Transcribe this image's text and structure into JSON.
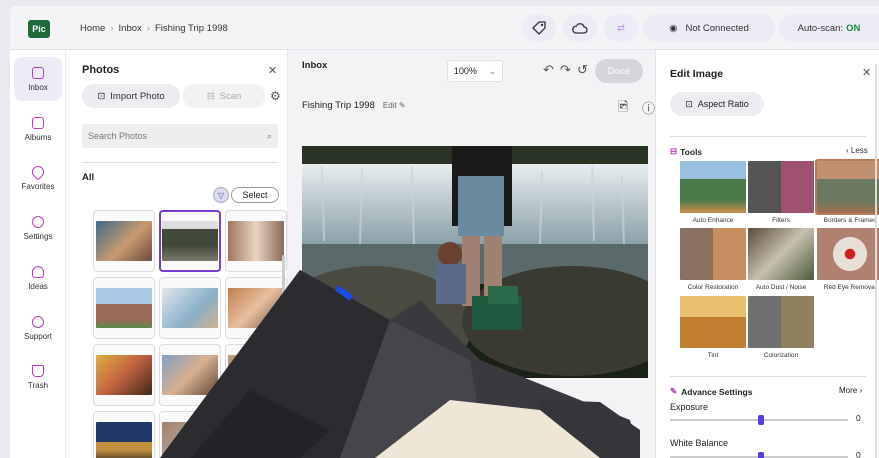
{
  "app": {
    "logo": "Pic"
  },
  "breadcrumb": [
    "Home",
    "Inbox",
    "Fishing Trip 1998"
  ],
  "topbar": {
    "connection": "Not Connected",
    "autoscan_label": "Auto-scan:",
    "autoscan_value": "ON"
  },
  "nav": [
    {
      "label": "Inbox",
      "icon": "inbox-icon",
      "active": true
    },
    {
      "label": "Albums",
      "icon": "albums-icon"
    },
    {
      "label": "Favorites",
      "icon": "heart-icon"
    },
    {
      "label": "Settings",
      "icon": "gear-icon"
    },
    {
      "label": "Ideas",
      "icon": "lightbulb-icon"
    },
    {
      "label": "Support",
      "icon": "help-icon"
    },
    {
      "label": "Trash",
      "icon": "trash-icon"
    }
  ],
  "photos": {
    "title": "Photos",
    "import_label": "Import Photo",
    "scan_label": "Scan",
    "search_placeholder": "Search Photos",
    "all_label": "All",
    "select_label": "Select"
  },
  "center": {
    "header": "Inbox",
    "zoom": "100%",
    "done": "Done",
    "album_title": "Fishing Trip 1998",
    "edit_label": "Edit"
  },
  "right": {
    "title": "Edit Image",
    "aspect_label": "Aspect Ratio",
    "tools_label": "Tools",
    "less_label": "Less",
    "tools": [
      {
        "label": "Auto Enhance"
      },
      {
        "label": "Filters"
      },
      {
        "label": "Borders & Frames"
      },
      {
        "label": "Color Restoration"
      },
      {
        "label": "Auto Dust / Noise"
      },
      {
        "label": "Red Eye Removal"
      },
      {
        "label": "Tint"
      },
      {
        "label": "Colorization"
      }
    ],
    "advance_label": "Advance Settings",
    "more_label": "More",
    "exposure_label": "Exposure",
    "exposure_value": "0",
    "wb_label": "White Balance",
    "wb_value": "0"
  },
  "colors": {
    "accent": "#7c3bd0",
    "brand": "#1e6b3a",
    "slider": "#5b3be0",
    "on": "#1b8a3a"
  }
}
